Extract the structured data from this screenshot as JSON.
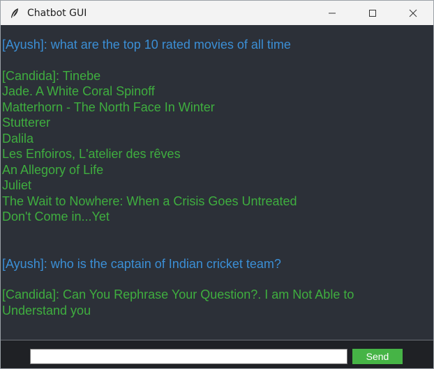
{
  "window": {
    "title": "Chatbot GUI"
  },
  "chat": {
    "messages": [
      {
        "lines": [
          "[Ayush]: what are the top 10 rated movies of all time"
        ]
      },
      {
        "lines": [
          "[Candida]: Tinebe",
          "Jade. A White Coral Spinoff",
          "Matterhorn - The North Face In Winter",
          "Stutterer",
          "Dalila",
          "Les Enfoiros, L'atelier des rêves",
          "An Allegory of Life",
          "Juliet",
          "The Wait to Nowhere: When a Crisis Goes Untreated",
          "Don't Come in...Yet"
        ]
      },
      {
        "lines": [
          "[Ayush]: who is the captain of Indian cricket team?"
        ]
      },
      {
        "lines": [
          "[Candida]: Can You Rephrase Your Question?. I am Not Able to",
          "Understand you"
        ]
      }
    ]
  },
  "footer": {
    "input_value": "",
    "send_label": "Send"
  },
  "colors": {
    "user": "#3b8fd6",
    "bot": "#3fae3f",
    "chat_bg": "#2c3038",
    "send_bg": "#46b446"
  },
  "icons": {
    "app": "feather-icon",
    "minimize": "minimize-icon",
    "maximize": "maximize-icon",
    "close": "close-icon"
  }
}
